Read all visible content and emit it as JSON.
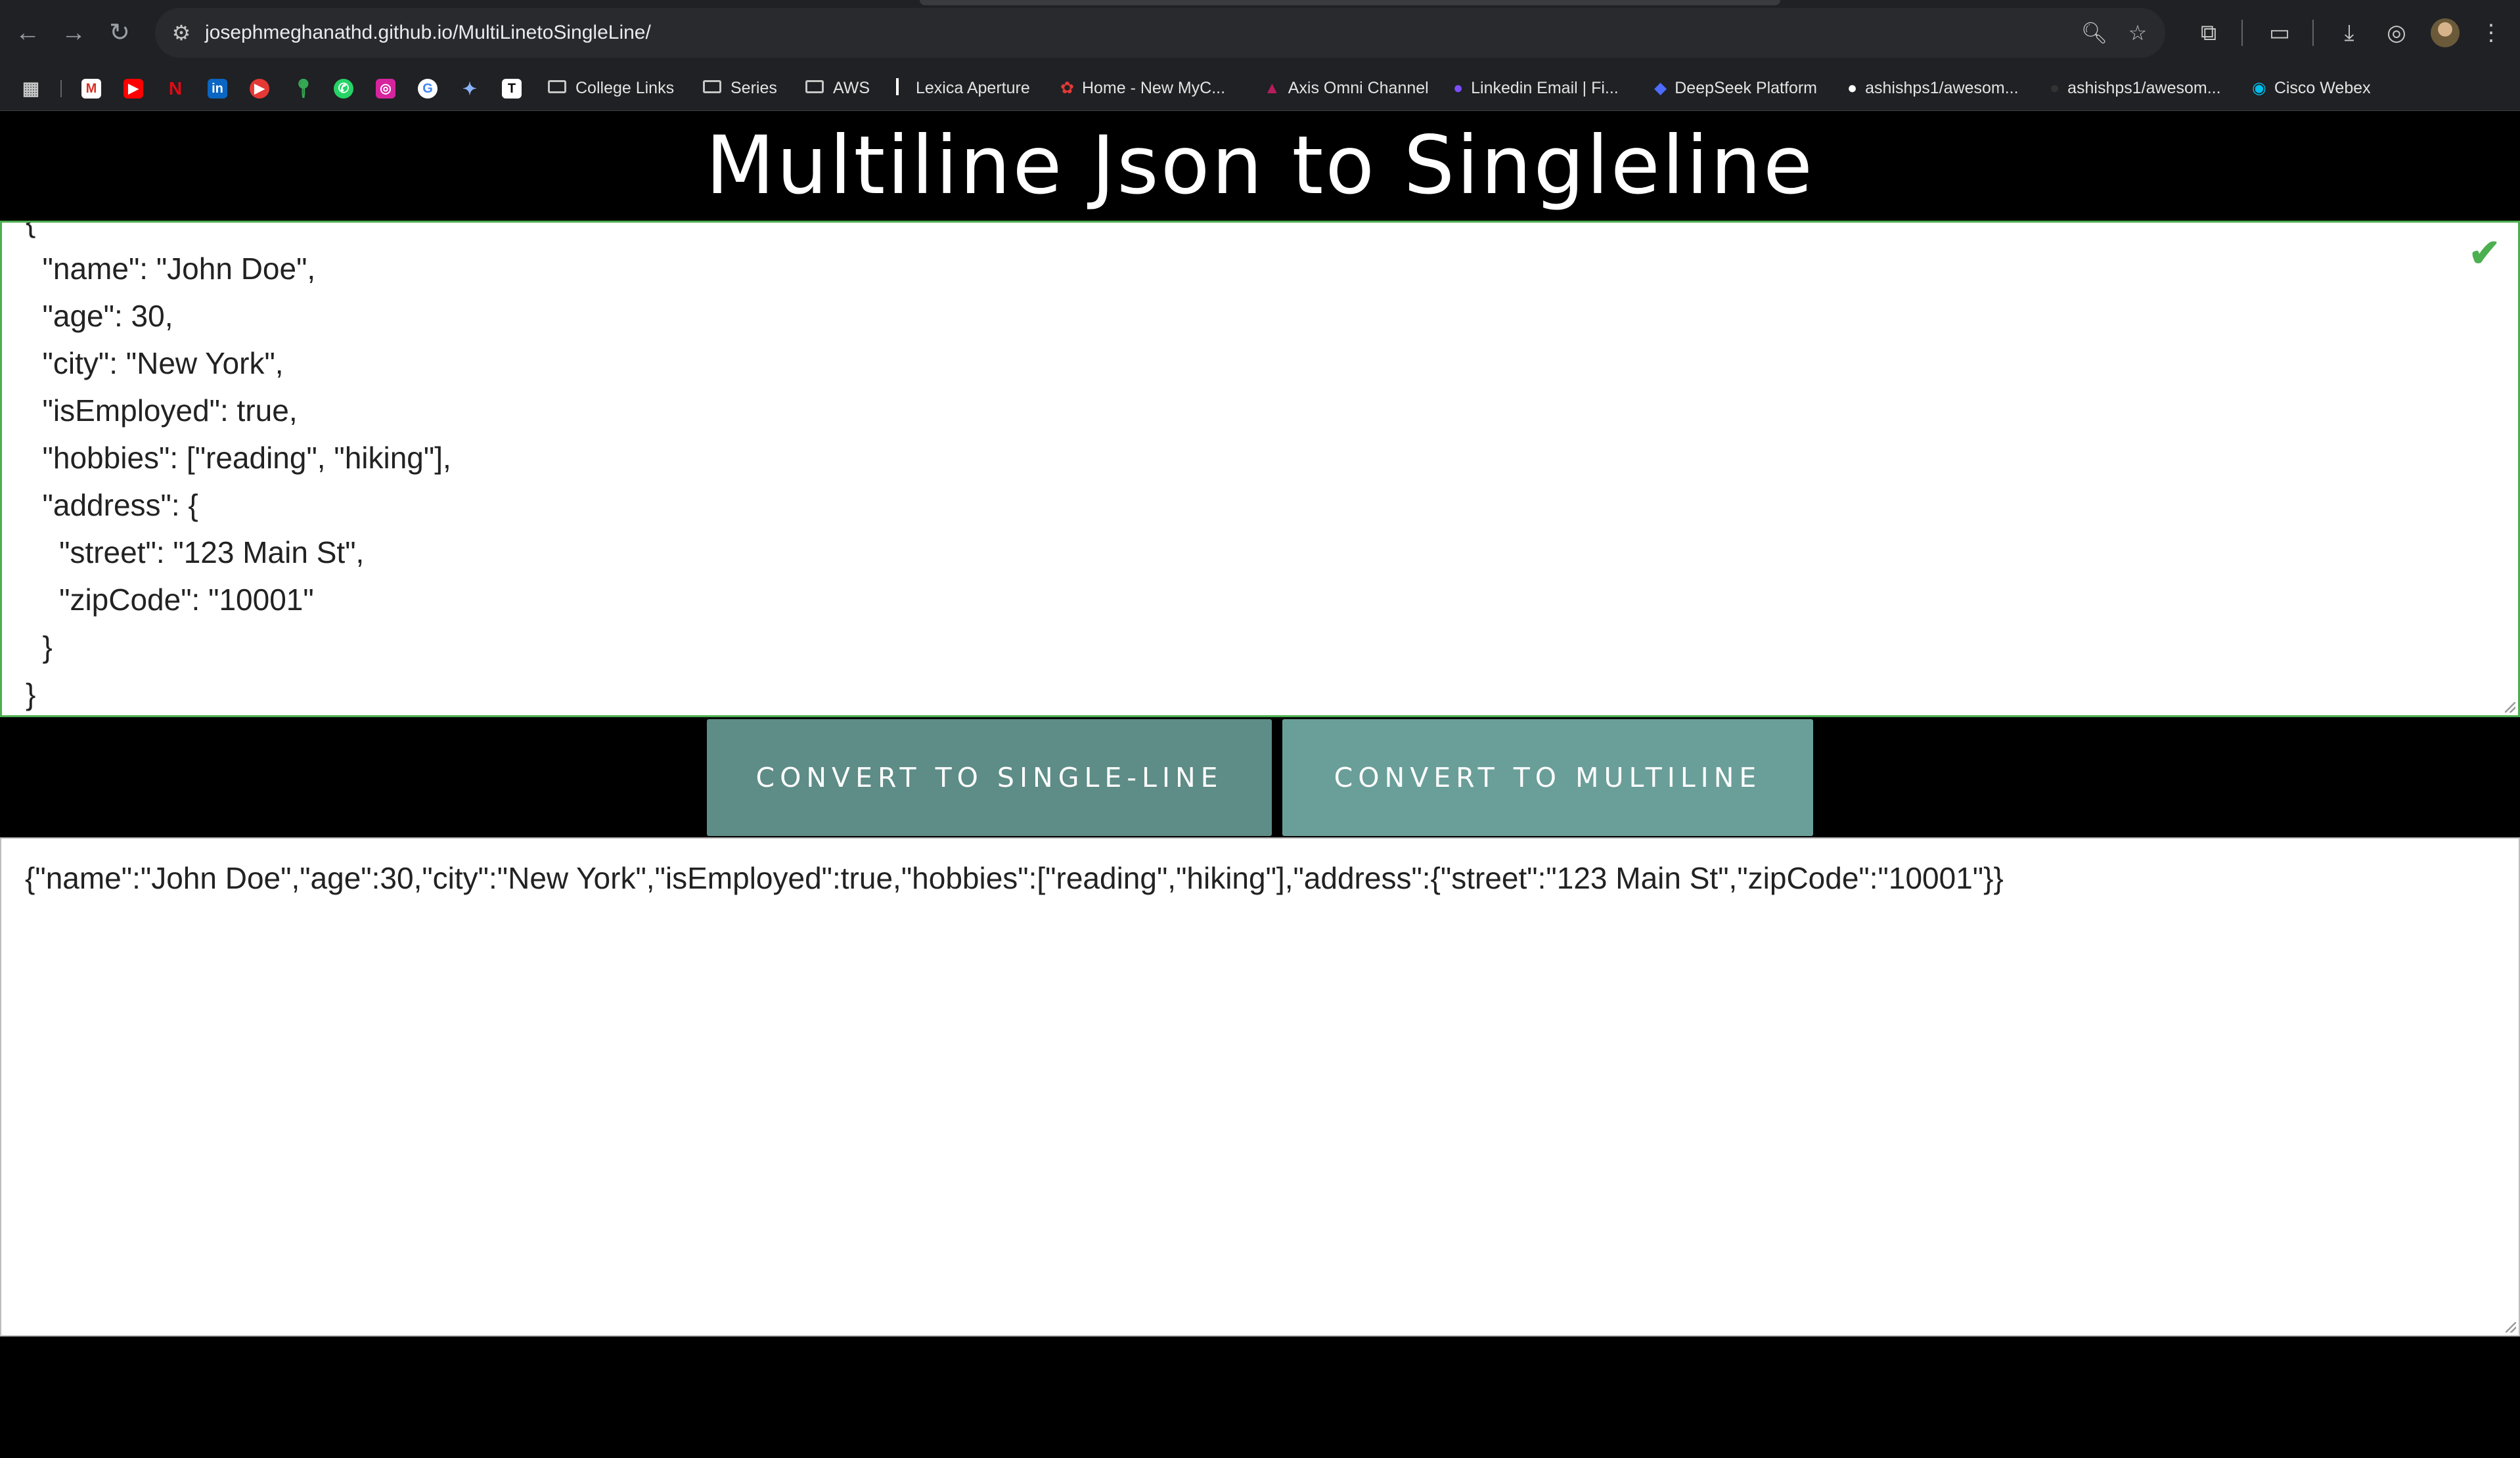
{
  "browser": {
    "url_host": "josephmeghanathd.github.io",
    "url_path": "/MultiLinetoSingleLine/",
    "bookmarks": [
      {
        "label": "College Links",
        "type": "folder"
      },
      {
        "label": "Series",
        "type": "folder"
      },
      {
        "label": "AWS",
        "type": "folder"
      },
      {
        "label": "Lexica Aperture",
        "type": "link"
      },
      {
        "label": "Home - New MyC...",
        "type": "link"
      },
      {
        "label": "Axis Omni Channel",
        "type": "link"
      },
      {
        "label": "Linkedin Email | Fi...",
        "type": "link"
      },
      {
        "label": "DeepSeek Platform",
        "type": "link"
      },
      {
        "label": "ashishps1/awesom...",
        "type": "link"
      },
      {
        "label": "ashishps1/awesom...",
        "type": "link"
      },
      {
        "label": "Cisco Webex",
        "type": "link"
      }
    ]
  },
  "page": {
    "title": "Multiline Json to Singleline",
    "input_text": "{\n  \"name\": \"John Doe\",\n  \"age\": 30,\n  \"city\": \"New York\",\n  \"isEmployed\": true,\n  \"hobbies\": [\"reading\", \"hiking\"],\n  \"address\": {\n    \"street\": \"123 Main St\",\n    \"zipCode\": \"10001\"\n  }\n}",
    "valid_icon": "checkmark-icon",
    "convert_single_label": "CONVERT TO SINGLE-LINE",
    "convert_multi_label": "CONVERT TO MULTILINE",
    "output_text": "{\"name\":\"John Doe\",\"age\":30,\"city\":\"New York\",\"isEmployed\":true,\"hobbies\":[\"reading\",\"hiking\"],\"address\":{\"street\":\"123 Main St\",\"zipCode\":\"10001\"}}"
  },
  "colors": {
    "background": "#000000",
    "valid_border": "#4caf50",
    "button_single": "#5e8c87",
    "button_multi": "#6a9e99"
  }
}
